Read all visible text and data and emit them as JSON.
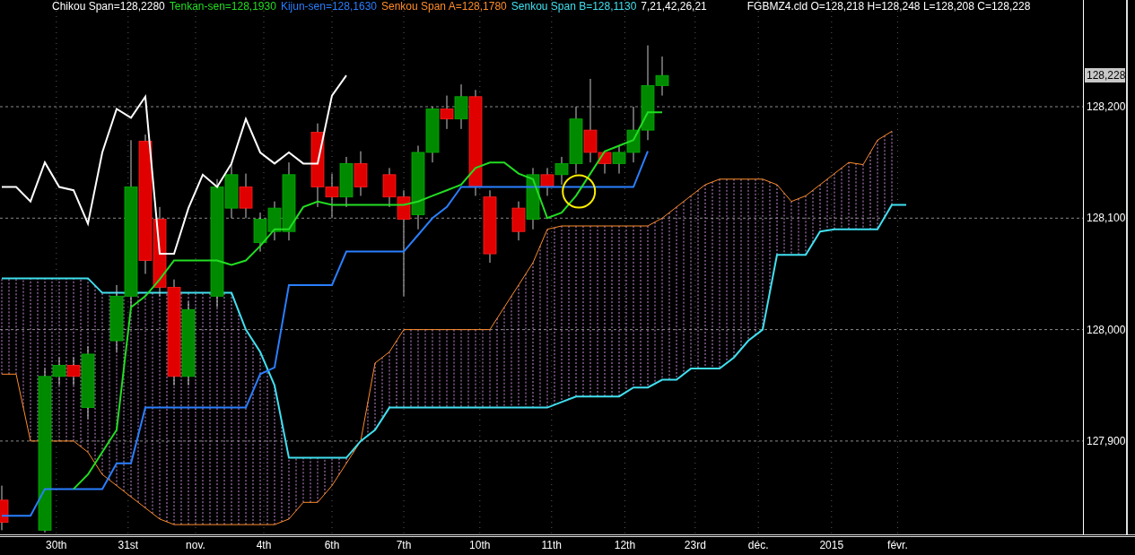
{
  "legend": [
    {
      "text": "Chikou Span=128,2280",
      "color": "#ffffff"
    },
    {
      "text": "Tenkan-sen=128,1930",
      "color": "#22dd22"
    },
    {
      "text": "Kijun-sen=128,1630",
      "color": "#2a7fff"
    },
    {
      "text": "Senkou Span A=128,1780",
      "color": "#ff8c2a"
    },
    {
      "text": "Senkou Span B=128,1130",
      "color": "#40e0f0"
    },
    {
      "text": "7,21,42,26,21",
      "color": "#ffffff"
    },
    {
      "text": "FGBMZ4.cld O=128,218 H=128,248 L=128,208 C=128,228",
      "color": "#ffffff"
    }
  ],
  "price_axis": {
    "ticks": [
      "128,200",
      "128,100",
      "128,000",
      "127,900"
    ],
    "last_price": "128,228"
  },
  "time_axis": {
    "labels": [
      "30th",
      "31st",
      "nov.",
      "4th",
      "6th",
      "7th",
      "10th",
      "11th",
      "12th",
      "23rd",
      "déc.",
      "2015",
      "févr."
    ]
  }
}
